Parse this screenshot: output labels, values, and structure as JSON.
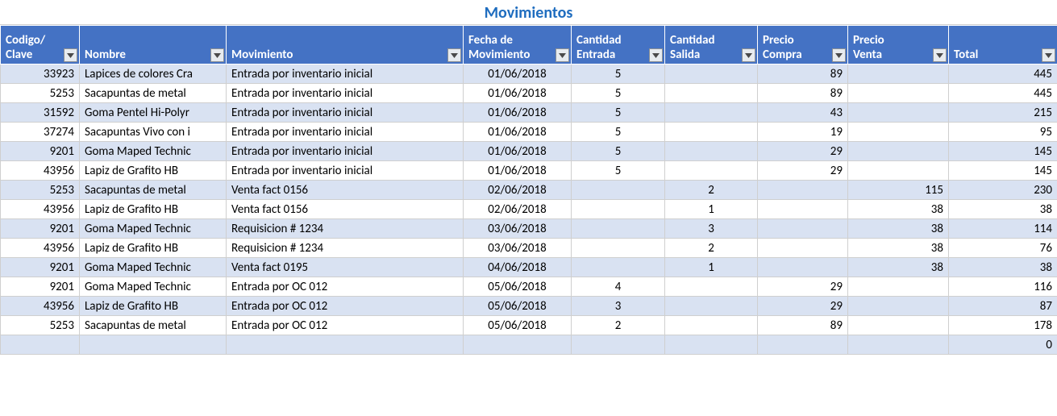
{
  "title": "Movimientos",
  "headers": {
    "codigo": "Codigo/\nClave",
    "nombre": "Nombre",
    "movimiento": "Movimiento",
    "fecha": "Fecha de\nMovimiento",
    "entrada": "Cantidad\nEntrada",
    "salida": "Cantidad\nSalida",
    "pcompra": "Precio\nCompra",
    "pventa": "Precio\nVenta",
    "total": "Total"
  },
  "rows": [
    {
      "codigo": "33923",
      "nombre": "Lapices de colores Cra",
      "mov": "Entrada por inventario inicial",
      "fecha": "01/06/2018",
      "ent": "5",
      "sal": "",
      "pc": "89",
      "pv": "",
      "tot": "445"
    },
    {
      "codigo": "5253",
      "nombre": "Sacapuntas de metal",
      "mov": "Entrada por inventario inicial",
      "fecha": "01/06/2018",
      "ent": "5",
      "sal": "",
      "pc": "89",
      "pv": "",
      "tot": "445"
    },
    {
      "codigo": "31592",
      "nombre": "Goma Pentel Hi-Polyr",
      "mov": "Entrada por inventario inicial",
      "fecha": "01/06/2018",
      "ent": "5",
      "sal": "",
      "pc": "43",
      "pv": "",
      "tot": "215"
    },
    {
      "codigo": "37274",
      "nombre": "Sacapuntas Vivo con i",
      "mov": "Entrada por inventario inicial",
      "fecha": "01/06/2018",
      "ent": "5",
      "sal": "",
      "pc": "19",
      "pv": "",
      "tot": "95"
    },
    {
      "codigo": "9201",
      "nombre": "Goma Maped Technic",
      "mov": "Entrada por inventario inicial",
      "fecha": "01/06/2018",
      "ent": "5",
      "sal": "",
      "pc": "29",
      "pv": "",
      "tot": "145"
    },
    {
      "codigo": "43956",
      "nombre": "Lapiz de Grafito HB",
      "mov": "Entrada por inventario inicial",
      "fecha": "01/06/2018",
      "ent": "5",
      "sal": "",
      "pc": "29",
      "pv": "",
      "tot": "145"
    },
    {
      "codigo": "5253",
      "nombre": "Sacapuntas de metal",
      "mov": "Venta fact 0156",
      "fecha": "02/06/2018",
      "ent": "",
      "sal": "2",
      "pc": "",
      "pv": "115",
      "tot": "230"
    },
    {
      "codigo": "43956",
      "nombre": "Lapiz de Grafito HB",
      "mov": "Venta fact 0156",
      "fecha": "02/06/2018",
      "ent": "",
      "sal": "1",
      "pc": "",
      "pv": "38",
      "tot": "38"
    },
    {
      "codigo": "9201",
      "nombre": "Goma Maped Technic",
      "mov": "Requisicion # 1234",
      "fecha": "03/06/2018",
      "ent": "",
      "sal": "3",
      "pc": "",
      "pv": "38",
      "tot": "114"
    },
    {
      "codigo": "43956",
      "nombre": "Lapiz de Grafito HB",
      "mov": "Requisicion # 1234",
      "fecha": "03/06/2018",
      "ent": "",
      "sal": "2",
      "pc": "",
      "pv": "38",
      "tot": "76"
    },
    {
      "codigo": "9201",
      "nombre": "Goma Maped Technic",
      "mov": "Venta fact 0195",
      "fecha": "04/06/2018",
      "ent": "",
      "sal": "1",
      "pc": "",
      "pv": "38",
      "tot": "38"
    },
    {
      "codigo": "9201",
      "nombre": "Goma Maped Technic",
      "mov": "Entrada por OC 012",
      "fecha": "05/06/2018",
      "ent": "4",
      "sal": "",
      "pc": "29",
      "pv": "",
      "tot": "116"
    },
    {
      "codigo": "43956",
      "nombre": "Lapiz de Grafito HB",
      "mov": "Entrada por OC 012",
      "fecha": "05/06/2018",
      "ent": "3",
      "sal": "",
      "pc": "29",
      "pv": "",
      "tot": "87"
    },
    {
      "codigo": "5253",
      "nombre": "Sacapuntas de metal",
      "mov": "Entrada por OC 012",
      "fecha": "05/06/2018",
      "ent": "2",
      "sal": "",
      "pc": "89",
      "pv": "",
      "tot": "178"
    },
    {
      "codigo": "",
      "nombre": "",
      "mov": "",
      "fecha": "",
      "ent": "",
      "sal": "",
      "pc": "",
      "pv": "",
      "tot": "0"
    }
  ]
}
